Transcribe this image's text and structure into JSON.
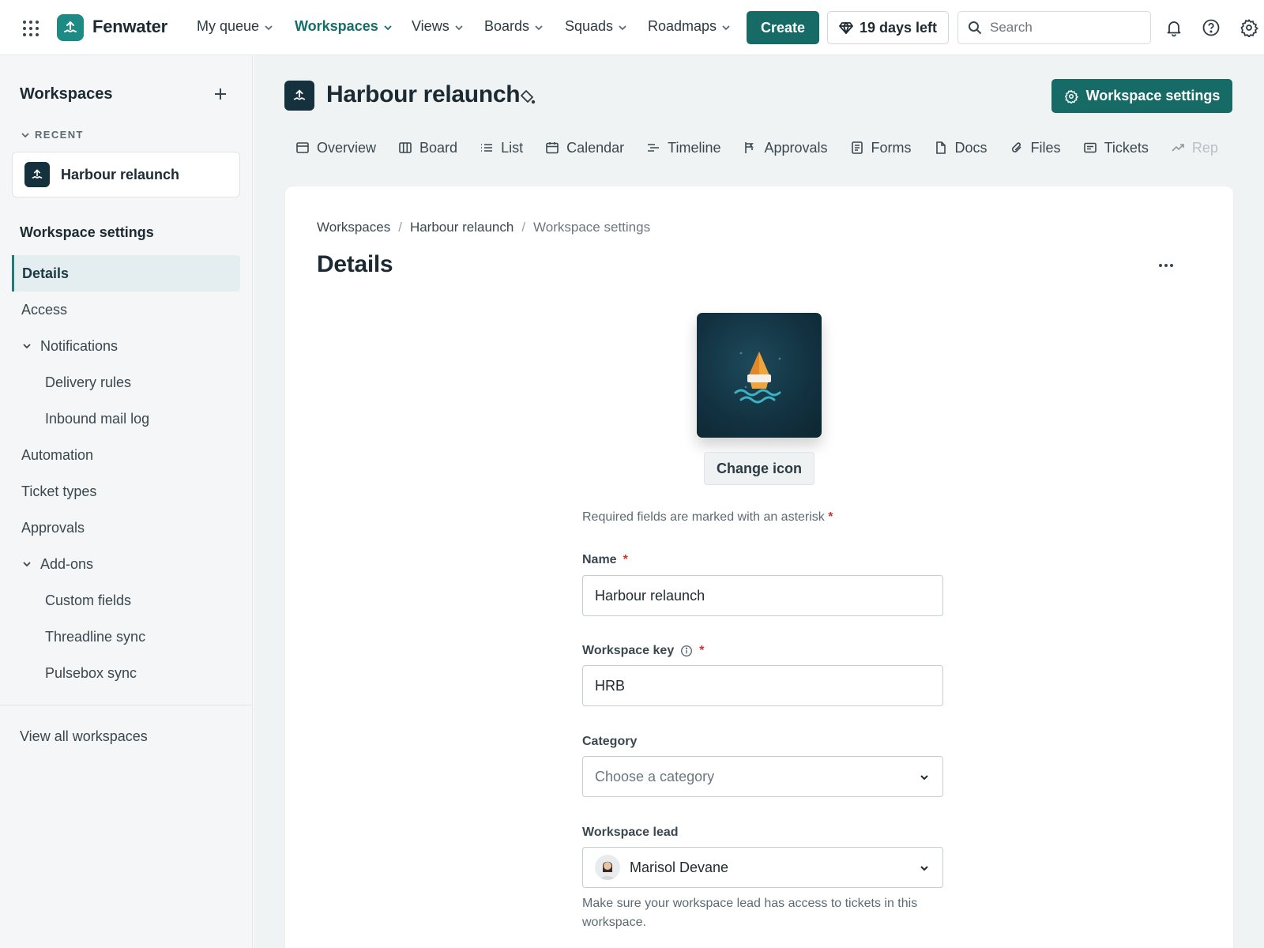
{
  "app": {
    "brand": "Fenwater",
    "nav": [
      {
        "label": "My queue"
      },
      {
        "label": "Workspaces"
      },
      {
        "label": "Views"
      },
      {
        "label": "Boards"
      },
      {
        "label": "Squads"
      },
      {
        "label": "Roadmaps"
      }
    ],
    "active_nav": "Workspaces",
    "create_label": "Create",
    "trial_label": "19 days left",
    "search_placeholder": "Search"
  },
  "sidebar": {
    "title": "Workspaces",
    "recent_label": "RECENT",
    "recent_workspace": "Harbour relaunch",
    "section_title": "Workspace settings",
    "items": [
      {
        "label": "Details"
      },
      {
        "label": "Access"
      },
      {
        "label": "Notifications"
      },
      {
        "label": "Delivery rules"
      },
      {
        "label": "Inbound mail log"
      },
      {
        "label": "Automation"
      },
      {
        "label": "Ticket types"
      },
      {
        "label": "Approvals"
      },
      {
        "label": "Add-ons"
      },
      {
        "label": "Custom fields"
      },
      {
        "label": "Threadline sync"
      },
      {
        "label": "Pulsebox sync"
      }
    ],
    "view_all": "View all workspaces"
  },
  "page": {
    "title": "Harbour relaunch",
    "settings_button": "Workspace settings",
    "tabs": [
      {
        "label": "Overview"
      },
      {
        "label": "Board"
      },
      {
        "label": "List"
      },
      {
        "label": "Calendar"
      },
      {
        "label": "Timeline"
      },
      {
        "label": "Approvals"
      },
      {
        "label": "Forms"
      },
      {
        "label": "Docs"
      },
      {
        "label": "Files"
      },
      {
        "label": "Tickets"
      },
      {
        "label": "Rep"
      }
    ]
  },
  "details": {
    "breadcrumbs": [
      "Workspaces",
      "Harbour relaunch",
      "Workspace settings"
    ],
    "title": "Details",
    "change_icon": "Change icon",
    "required_note": "Required fields are marked with an asterisk",
    "asterisk": "*",
    "name_label": "Name",
    "name_value": "Harbour relaunch",
    "key_label": "Workspace key",
    "key_value": "HRB",
    "category_label": "Category",
    "category_placeholder": "Choose a category",
    "lead_label": "Workspace lead",
    "lead_value": "Marisol Devane",
    "lead_helper": "Make sure your workspace lead has access to tickets in this workspace."
  },
  "colors": {
    "accent": "#166b67",
    "required": "#c9372c",
    "sidebar_bg": "#f4f6f7",
    "main_bg": "#eff3f4"
  },
  "icons": [
    "app-grid-icon",
    "fenwater-logo-icon",
    "chevron-down-icon",
    "gem-icon",
    "search-icon",
    "bell-icon",
    "help-icon",
    "gear-icon",
    "plus-icon",
    "paint-bucket-icon",
    "more-icon",
    "info-icon"
  ]
}
